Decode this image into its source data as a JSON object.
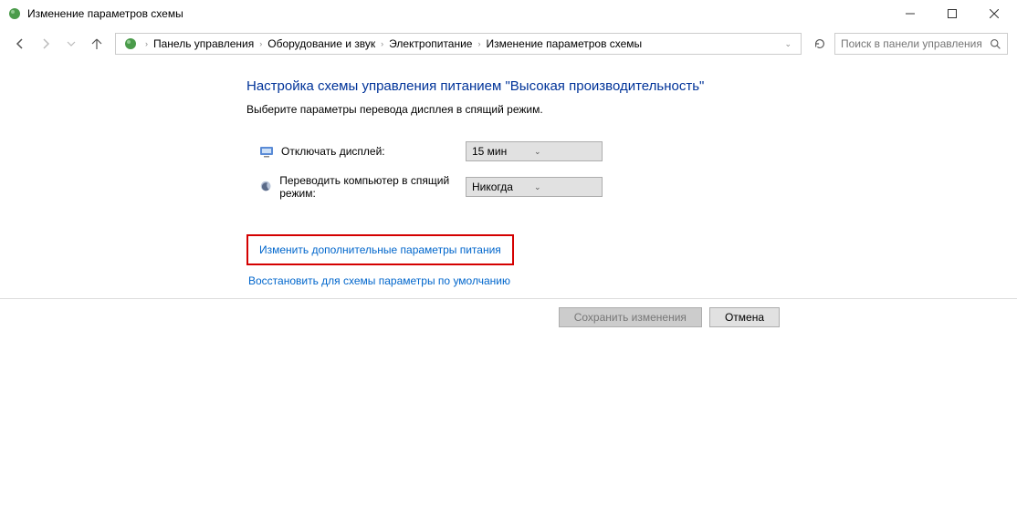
{
  "window": {
    "title": "Изменение параметров схемы"
  },
  "breadcrumb": {
    "items": [
      "Панель управления",
      "Оборудование и звук",
      "Электропитание",
      "Изменение параметров схемы"
    ]
  },
  "search": {
    "placeholder": "Поиск в панели управления"
  },
  "main": {
    "heading": "Настройка схемы управления питанием \"Высокая производительность\"",
    "subheading": "Выберите параметры перевода дисплея в спящий режим.",
    "settings": [
      {
        "label": "Отключать дисплей:",
        "value": "15 мин"
      },
      {
        "label": "Переводить компьютер в спящий режим:",
        "value": "Никогда"
      }
    ],
    "link_advanced": "Изменить дополнительные параметры питания",
    "link_restore": "Восстановить для схемы параметры по умолчанию"
  },
  "footer": {
    "save": "Сохранить изменения",
    "cancel": "Отмена"
  }
}
